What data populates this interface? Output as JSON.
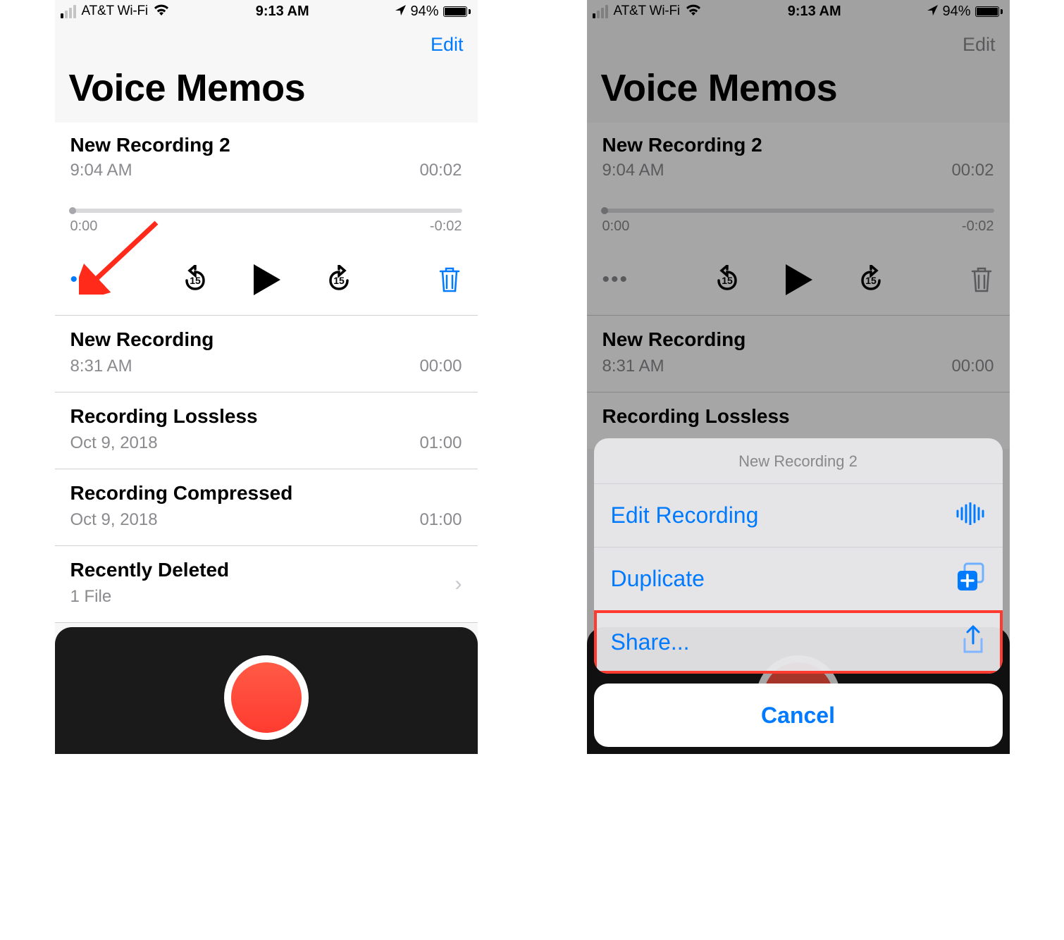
{
  "status": {
    "carrier": "AT&T Wi-Fi",
    "time": "9:13 AM",
    "battery_pct": "94%"
  },
  "nav": {
    "edit": "Edit",
    "title": "Voice Memos"
  },
  "player": {
    "title": "New Recording 2",
    "time": "9:04 AM",
    "duration": "00:02",
    "elapsed": "0:00",
    "remaining": "-0:02"
  },
  "recordings": [
    {
      "title": "New Recording",
      "time": "8:31 AM",
      "duration": "00:00"
    },
    {
      "title": "Recording Lossless",
      "time": "Oct 9, 2018",
      "duration": "01:00"
    },
    {
      "title": "Recording Compressed",
      "time": "Oct 9, 2018",
      "duration": "01:00"
    }
  ],
  "trash": {
    "title": "Recently Deleted",
    "count": "1 File"
  },
  "sheet": {
    "title": "New Recording 2",
    "items": [
      {
        "label": "Edit Recording",
        "icon": "waveform-icon"
      },
      {
        "label": "Duplicate",
        "icon": "duplicate-icon"
      },
      {
        "label": "Share...",
        "icon": "share-icon"
      }
    ],
    "cancel": "Cancel"
  }
}
